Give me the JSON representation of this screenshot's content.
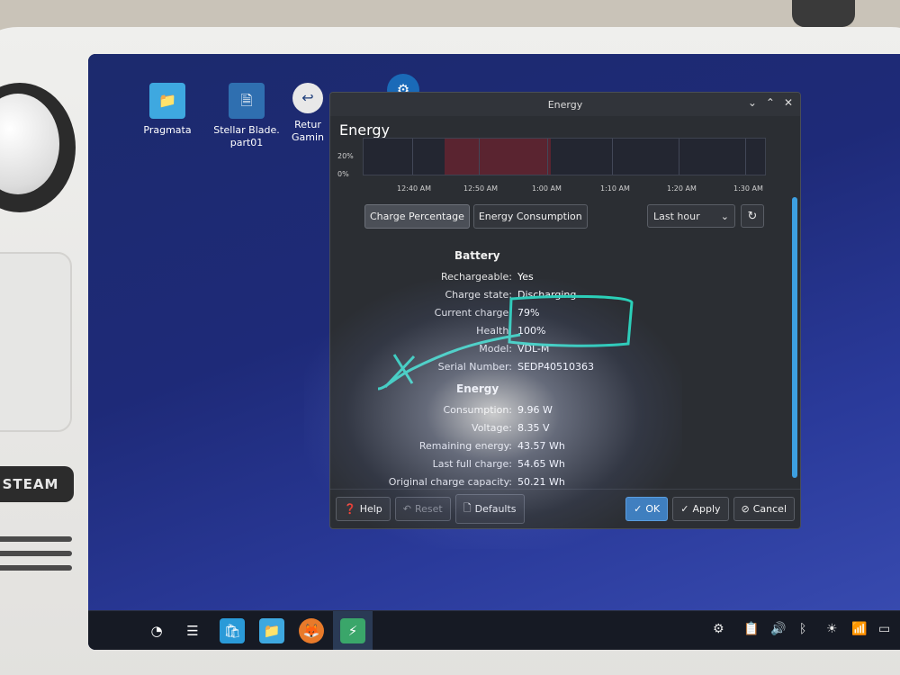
{
  "device": {
    "steam_button_label": "STEAM"
  },
  "desktop": {
    "icons": [
      {
        "label": "Pragmata",
        "icon": "folder-icon"
      },
      {
        "label": "Stellar Blade.\npart01",
        "icon": "file-icon"
      },
      {
        "label": "Retur\nGamin",
        "icon": "return-gaming-icon"
      },
      {
        "label": "",
        "icon": "steam-icon"
      }
    ]
  },
  "window": {
    "title": "Energy",
    "heading": "Energy",
    "graph": {
      "y_labels": [
        "20%",
        "0%"
      ],
      "x_labels": [
        "12:40 AM",
        "12:50 AM",
        "1:00 AM",
        "1:10 AM",
        "1:20 AM",
        "1:30 AM"
      ]
    },
    "tabs": [
      "Charge Percentage",
      "Energy Consumption"
    ],
    "range_select": "Last hour",
    "battery": {
      "title": "Battery",
      "rows": [
        {
          "k": "Rechargeable:",
          "v": "Yes"
        },
        {
          "k": "Charge state:",
          "v": "Discharging"
        },
        {
          "k": "Current charge:",
          "v": "79%"
        },
        {
          "k": "Health:",
          "v": "100%"
        },
        {
          "k": "Model:",
          "v": "VDL-M"
        },
        {
          "k": "Serial Number:",
          "v": "SEDP40510363"
        }
      ]
    },
    "energy": {
      "title": "Energy",
      "rows": [
        {
          "k": "Consumption:",
          "v": "9.96 W"
        },
        {
          "k": "Voltage:",
          "v": "8.35 V"
        },
        {
          "k": "Remaining energy:",
          "v": "43.57 Wh"
        },
        {
          "k": "Last full charge:",
          "v": "54.65 Wh"
        },
        {
          "k": "Original charge capacity:",
          "v": "50.21 Wh"
        }
      ]
    },
    "buttons": {
      "help": "Help",
      "reset": "Reset",
      "defaults": "Defaults",
      "ok": "OK",
      "apply": "Apply",
      "cancel": "Cancel"
    }
  },
  "colors": {
    "accent": "#3d9fe0",
    "annotation": "#2ad0b8",
    "graph_highlight": "#5a2430"
  }
}
